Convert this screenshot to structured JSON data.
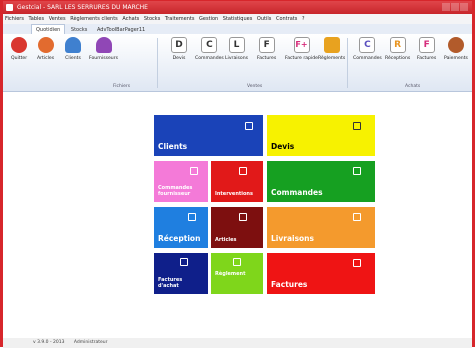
{
  "window": {
    "title": "Gestcial - SARL LES SERRURES DU MARCHE"
  },
  "menubar": [
    "Fichiers",
    "Tables",
    "Ventes",
    "Règlements clients",
    "Achats",
    "Stocks",
    "Traitements",
    "Gestion",
    "Statistiques",
    "Outils",
    "Contrats",
    "?"
  ],
  "ribbon_tabs": [
    {
      "label": "Quotidien",
      "active": true
    },
    {
      "label": "Stocks",
      "active": false
    },
    {
      "label": "AdvToolBarPager11",
      "active": false
    }
  ],
  "ribbon": {
    "groups": [
      {
        "label": "Fichiers"
      },
      {
        "label": "Ventes"
      },
      {
        "label": "Achats"
      }
    ],
    "buttons": [
      {
        "label": "Quitter",
        "icon": "power-icon",
        "color": "#d9362f"
      },
      {
        "label": "Articles",
        "icon": "articles-icon",
        "color": "#e26b2f"
      },
      {
        "label": "Clients",
        "icon": "clients-icon",
        "color": "#3f80cf"
      },
      {
        "label": "Fournisseurs",
        "icon": "suppliers-icon",
        "color": "#9047b6"
      },
      {
        "label": "Devis",
        "icon": "document-d-icon",
        "color": "#6b6b7a",
        "glyph": "D"
      },
      {
        "label": "Commandes",
        "icon": "document-c-icon",
        "color": "#6b6b7a",
        "glyph": "C"
      },
      {
        "label": "Livraisons",
        "icon": "document-l-icon",
        "color": "#6b6b7a",
        "glyph": "L"
      },
      {
        "label": "Factures",
        "icon": "document-f-icon",
        "color": "#6b6b7a",
        "glyph": "F"
      },
      {
        "label": "Facture rapide",
        "icon": "document-fplus-icon",
        "color": "#d62b7a",
        "glyph": "F+"
      },
      {
        "label": "Règlements",
        "icon": "payments-icon",
        "color": "#e8a21f"
      },
      {
        "label": "Commandes",
        "icon": "document-c-purple-icon",
        "color": "#5a4fbf",
        "glyph": "C"
      },
      {
        "label": "Réceptions",
        "icon": "document-r-icon",
        "color": "#e89420",
        "glyph": "R"
      },
      {
        "label": "Factures",
        "icon": "document-f-pink-icon",
        "color": "#d62b7a",
        "glyph": "F"
      },
      {
        "label": "Paiements",
        "icon": "coins-icon",
        "color": "#b25b2b"
      }
    ]
  },
  "tiles": [
    {
      "label": "Clients",
      "color": "#1a43b8",
      "icon": "person-icon"
    },
    {
      "label": "Devis",
      "color": "#f7f200",
      "icon": "quote-icon"
    },
    {
      "label": "Commandes fournisseur",
      "color": "#f47ad8",
      "icon": "supplier-order-icon"
    },
    {
      "label": "Interventions",
      "color": "#e11919",
      "icon": "walking-person-icon"
    },
    {
      "label": "Commandes",
      "color": "#16a021",
      "icon": "order-icon"
    },
    {
      "label": "Réception",
      "color": "#1f7fe0",
      "icon": "reception-icon"
    },
    {
      "label": "Articles",
      "color": "#7d0f0f",
      "icon": "grid-icon"
    },
    {
      "label": "Livraisons",
      "color": "#f49a2d",
      "icon": "delivery-icon"
    },
    {
      "label": "Factures d'achat",
      "color": "#0f1f8a",
      "icon": "purchase-invoice-icon"
    },
    {
      "label": "Règlement",
      "color": "#7fd61b",
      "icon": "payment-icon"
    },
    {
      "label": "Factures",
      "color": "#ef1414",
      "icon": "invoice-icon"
    }
  ],
  "status": {
    "version": "v 3.9.0 - 2013",
    "user": "Administrateur"
  }
}
